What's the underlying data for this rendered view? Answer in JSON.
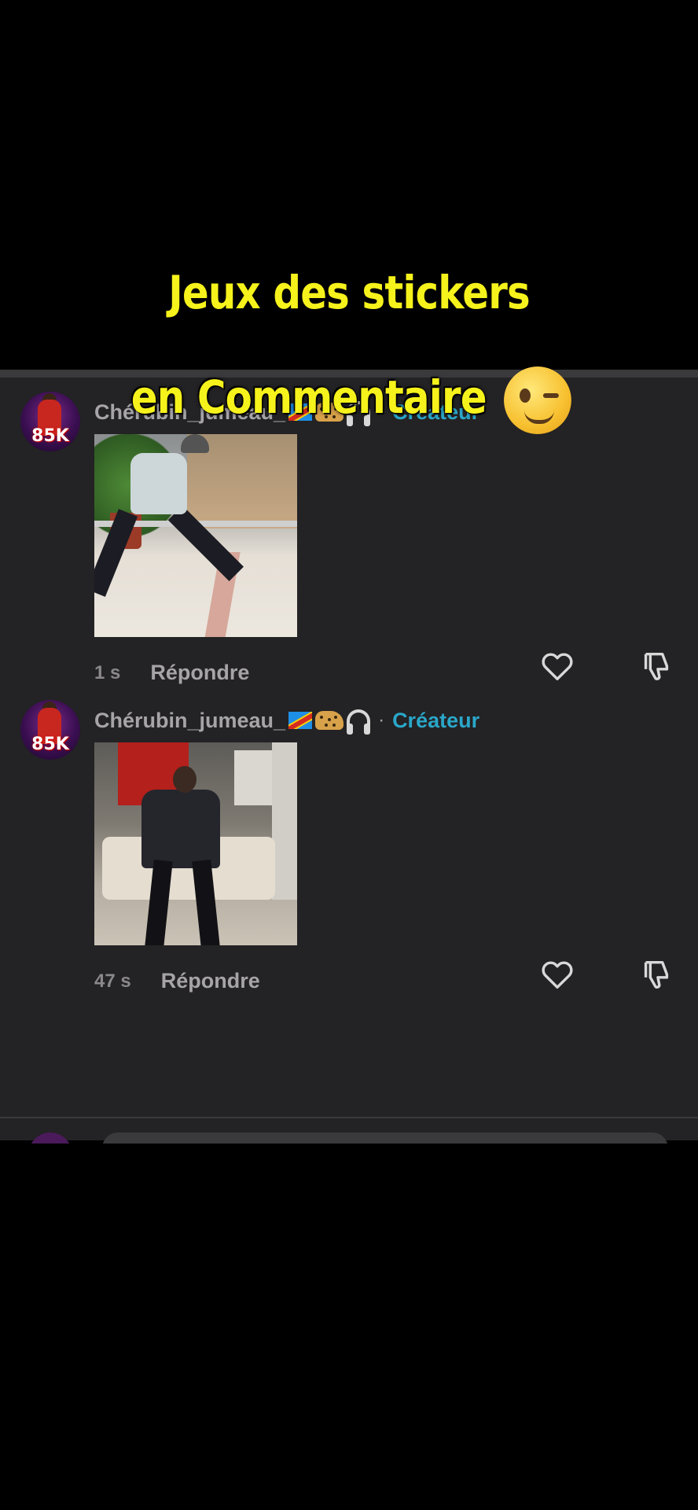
{
  "overlay": {
    "line1": "Jeux des stickers",
    "line2": "en Commentaire"
  },
  "comments": [
    {
      "avatar_badge": "85K",
      "username": "Chérubin_jumeau_",
      "separator": "·",
      "role": "Créateur",
      "time": "1 s",
      "reply": "Répondre"
    },
    {
      "avatar_badge": "85K",
      "username": "Chérubin_jumeau_",
      "separator": "·",
      "role": "Créateur",
      "time": "47 s",
      "reply": "Répondre"
    }
  ],
  "colors": {
    "panel": "#232224",
    "overlay_text": "#f6f21b",
    "creator": "#2aa7c9",
    "username": "#a6a4a8"
  },
  "icons": [
    "heart-icon",
    "dislike-icon",
    "headphones-icon",
    "flag-icon",
    "leopard-icon",
    "wink-emoji-icon"
  ]
}
